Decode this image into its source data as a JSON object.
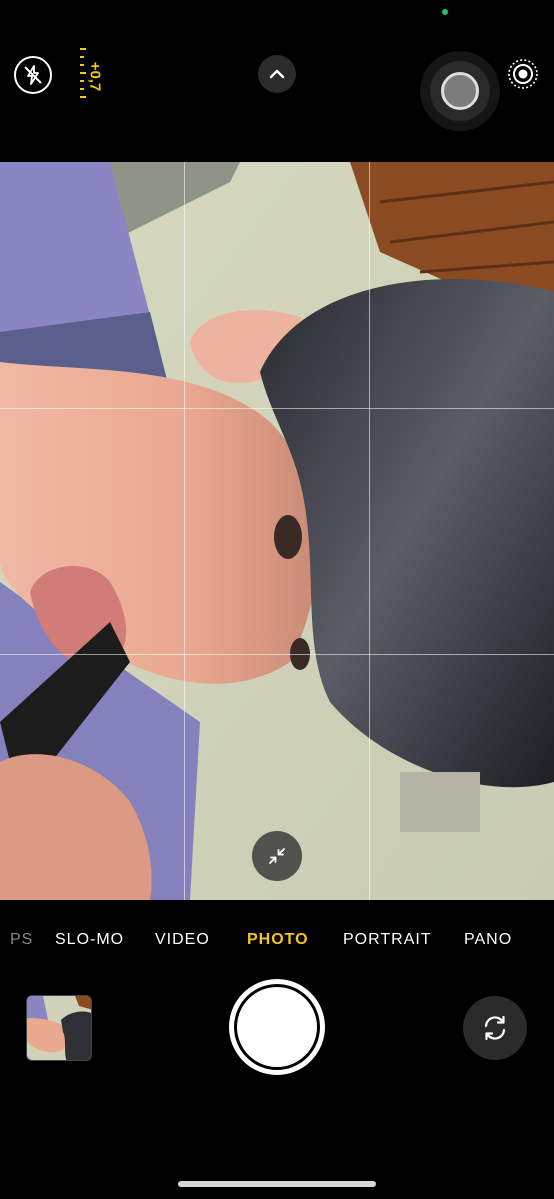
{
  "colors": {
    "accent": "#f5c518",
    "background": "#000000",
    "status_dot": "#22c55e",
    "control_bg": "#2b2b2b"
  },
  "top_controls": {
    "flash_icon": "flash-off-icon",
    "exposure_value": "+0,7",
    "chevron_icon": "chevron-up-icon",
    "live_photo_icon": "live-photo-icon"
  },
  "viewfinder": {
    "grid": true,
    "zoom_icon": "minimize-arrows-icon"
  },
  "modes": {
    "items": [
      {
        "label": "PSE",
        "state": "partial"
      },
      {
        "label": "SLO-MO",
        "state": "normal"
      },
      {
        "label": "VIDEO",
        "state": "normal"
      },
      {
        "label": "PHOTO",
        "state": "active"
      },
      {
        "label": "PORTRAIT",
        "state": "normal"
      },
      {
        "label": "PANO",
        "state": "normal"
      }
    ]
  },
  "bottom_controls": {
    "thumbnail": "last-photo-thumbnail",
    "shutter": "shutter-button",
    "flip_icon": "camera-flip-icon"
  }
}
